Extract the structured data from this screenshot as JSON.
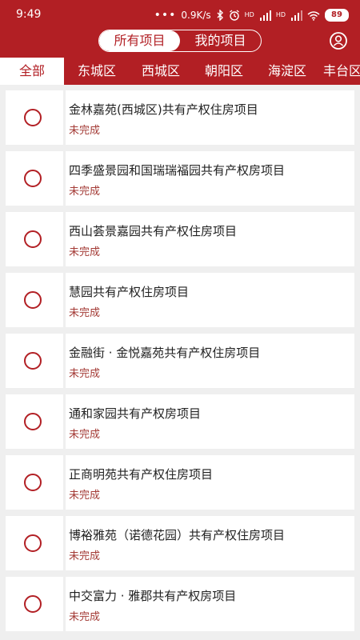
{
  "status_bar": {
    "time": "9:49",
    "dots": "•••",
    "network_speed": "0.9K/s",
    "network_1": "HD",
    "network_2": "HD",
    "battery": "89"
  },
  "header": {
    "segments": [
      {
        "label": "所有项目",
        "active": true
      },
      {
        "label": "我的项目",
        "active": false
      }
    ],
    "user_icon": "user-icon"
  },
  "tabs": [
    {
      "label": "全部",
      "active": true
    },
    {
      "label": "东城区",
      "active": false
    },
    {
      "label": "西城区",
      "active": false
    },
    {
      "label": "朝阳区",
      "active": false
    },
    {
      "label": "海淀区",
      "active": false
    },
    {
      "label": "丰台区",
      "active": false
    }
  ],
  "projects": [
    {
      "title": "金林嘉苑(西城区)共有产权住房项目",
      "status": "未完成"
    },
    {
      "title": "四季盛景园和国瑞瑞福园共有产权房项目",
      "status": "未完成"
    },
    {
      "title": "西山荟景嘉园共有产权住房项目",
      "status": "未完成"
    },
    {
      "title": "慧园共有产权住房项目",
      "status": "未完成"
    },
    {
      "title": "金融街 · 金悦嘉苑共有产权住房项目",
      "status": "未完成"
    },
    {
      "title": "通和家园共有产权房项目",
      "status": "未完成"
    },
    {
      "title": "正商明苑共有产权住房项目",
      "status": "未完成"
    },
    {
      "title": "博裕雅苑（诺德花园）共有产权住房项目",
      "status": "未完成"
    },
    {
      "title": "中交富力 · 雅郡共有产权房项目",
      "status": "未完成"
    }
  ],
  "colors": {
    "brand": "#b21f24",
    "status_text": "#a33a35",
    "background": "#efefef"
  }
}
